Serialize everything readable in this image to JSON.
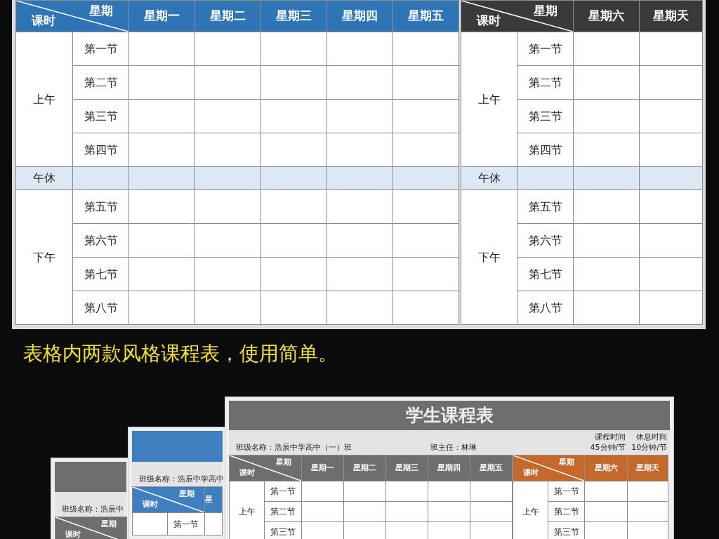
{
  "top_schedule": {
    "halves": [
      {
        "color": "#2e75b6",
        "corner_top": "星期",
        "corner_bottom": "课时",
        "days": [
          "星期一",
          "星期二",
          "星期三",
          "星期四",
          "星期五"
        ],
        "rows": [
          {
            "kind": "session",
            "label": "上午",
            "lessons": [
              "第一节",
              "第二节",
              "第三节",
              "第四节"
            ]
          },
          {
            "kind": "break",
            "label": "午休"
          },
          {
            "kind": "session",
            "label": "下午",
            "lessons": [
              "第五节",
              "第六节",
              "第七节",
              "第八节"
            ]
          }
        ]
      },
      {
        "color": "#3a3a3a",
        "corner_top": "星期",
        "corner_bottom": "课时",
        "days": [
          "星期六",
          "星期天"
        ],
        "rows": [
          {
            "kind": "session",
            "label": "上午",
            "lessons": [
              "第一节",
              "第二节",
              "第三节",
              "第四节"
            ]
          },
          {
            "kind": "break",
            "label": "午休"
          },
          {
            "kind": "session",
            "label": "下午",
            "lessons": [
              "第五节",
              "第六节",
              "第七节",
              "第八节"
            ]
          }
        ]
      }
    ]
  },
  "caption": "表格内两款风格课程表，使用简单。",
  "cards": [
    {
      "color": "#6e6e6e",
      "class_name": "班级名称：浩辰中",
      "halves": [
        {
          "color": "#6e6e6e",
          "corner_top": "星期",
          "corner_bottom": "课时"
        }
      ]
    },
    {
      "color": "#3f7fbf",
      "class_name": "班级名称：浩辰中学高中",
      "halves": [
        {
          "color": "#3f7fbf",
          "corner_top": "星期",
          "corner_bottom": "课时",
          "days": [
            "星"
          ],
          "rows": [
            {
              "kind": "session",
              "lessons": [
                "第一节"
              ]
            }
          ]
        }
      ]
    },
    {
      "color": "#6e6e6e",
      "title": "学生课程表",
      "class_name": "班级名称：浩辰中学高中（一）班",
      "head_teacher": "班主任：林琳",
      "times": [
        {
          "label": "课程时间",
          "value": "45分钟/节"
        },
        {
          "label": "休息时间",
          "value": "10分钟/节"
        }
      ],
      "halves": [
        {
          "color": "#6e6e6e",
          "corner_top": "星期",
          "corner_bottom": "课时",
          "days": [
            "星期一",
            "星期二",
            "星期三",
            "星期四",
            "星期五"
          ],
          "rows": [
            {
              "kind": "session",
              "label": "上午",
              "lessons": [
                "第一节",
                "第二节",
                "第三节"
              ]
            }
          ]
        },
        {
          "color": "#c5682c",
          "corner_top": "星期",
          "corner_bottom": "课时",
          "days": [
            "星期六",
            "星期天"
          ],
          "rows": [
            {
              "kind": "session",
              "label": "上午",
              "lessons": [
                "第一节",
                "第二节",
                "第三节"
              ]
            }
          ]
        }
      ]
    }
  ]
}
